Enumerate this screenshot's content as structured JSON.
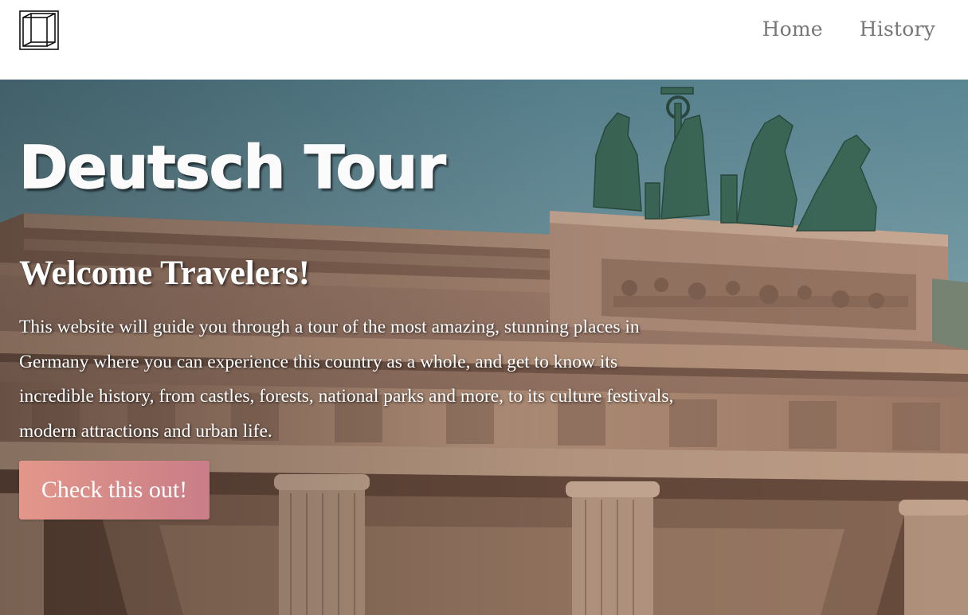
{
  "header": {
    "logo_icon": "cube-frame-icon",
    "nav": [
      {
        "label": "Home"
      },
      {
        "label": "History"
      }
    ]
  },
  "hero": {
    "title": "Deutsch Tour",
    "heading": "Welcome Travelers!",
    "paragraph": "This website will guide you through a tour of the most amazing, stunning places in Germany where you can experience this country as a whole, and get to know its incredible history, from castles, forests, national parks and more, to its culture festivals, modern attractions and urban life.",
    "cta_label": "Check this out!",
    "background_image": "brandenburg-gate-quadriga-photo"
  },
  "colors": {
    "nav_text": "#777777",
    "cta_gradient_start": "#e3978a",
    "cta_gradient_end": "#c97d87",
    "sky": "#7fa7b4",
    "stone": "#b98e72"
  }
}
